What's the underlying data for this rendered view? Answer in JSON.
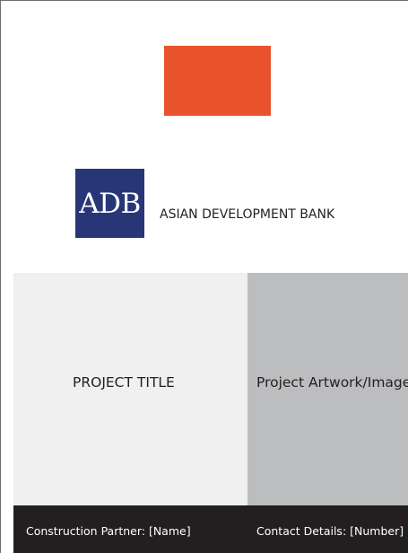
{
  "colors": {
    "accent_orange": "#e9532b",
    "adb_blue": "#283677",
    "footer_dark": "#231f20",
    "title_panel_bg": "#f0f0f0",
    "artwork_panel_bg": "#bcbdbf"
  },
  "logo": {
    "text": "ADB",
    "icon": "adb-logo"
  },
  "bank_name": "ASIAN DEVELOPMENT BANK",
  "project_title": "PROJECT TITLE",
  "project_artwork": "Project Artwork/Image",
  "footer": {
    "construction_partner": "Construction Partner: [Name]",
    "contact_details": "Contact Details: [Number]"
  }
}
